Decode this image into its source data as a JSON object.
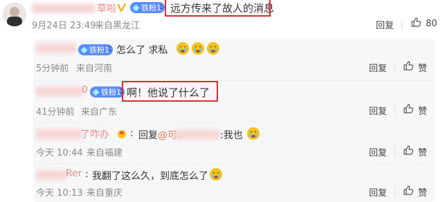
{
  "main_comment": {
    "user_name": "草啦",
    "fan_badge": "铁粉1",
    "text": "远方传来了故人的消息",
    "time": "9月24日 23:49",
    "location": "来自黑龙江",
    "reply_label": "回复",
    "like_count": "80"
  },
  "replies": [
    {
      "user_name": "",
      "fan_badge": "铁粉1",
      "text": "怎么了 求私",
      "time": "5分钟前",
      "location": "来自河南",
      "reply_label": "回复",
      "like_label": "赞"
    },
    {
      "user_name": "0",
      "fan_badge": "铁粉1",
      "text": "啊！他说了什么了",
      "time": "41分钟前",
      "location": "来自广东",
      "reply_label": "回复",
      "like_label": "赞"
    },
    {
      "user_name": "了咋办",
      "text_prefix": "回复",
      "mention": "@可…",
      "text": ":我也",
      "time": "今天 10:44",
      "location": "来自福建",
      "reply_label": "回复",
      "like_label": "赞"
    },
    {
      "user_name": "Rer",
      "text": "我翻了这么久，到底怎么了",
      "time": "今天 10:13",
      "location": "来自重庆",
      "reply_label": "回复",
      "like_label": "赞"
    }
  ],
  "colors": {
    "accent_red": "#e0282e",
    "name_pink": "#f08a8a",
    "fan_badge_blue": "#5a8cff",
    "gray_text": "#8a8a8a"
  }
}
